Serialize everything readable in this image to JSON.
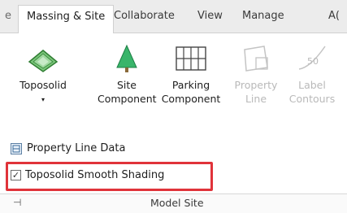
{
  "tabs": {
    "partial_left": "e",
    "items": [
      "Massing & Site",
      "Collaborate",
      "View",
      "Manage",
      "A("
    ]
  },
  "ribbon": {
    "toposolid": {
      "label": "Toposolid",
      "caret": "▾"
    },
    "site_component": {
      "line1": "Site",
      "line2": "Component"
    },
    "parking_component": {
      "line1": "Parking",
      "line2": "Component"
    },
    "property_line": {
      "line1": "Property",
      "line2": "Line"
    },
    "label_contours": {
      "line1": "Label",
      "line2": "Contours",
      "icon_text": "50"
    }
  },
  "panel": {
    "property_line_data": "Property Line Data",
    "smooth_shading": {
      "label": "Toposolid Smooth Shading",
      "checked": true
    },
    "title": "Model Site",
    "pin_glyph": "⊣"
  },
  "colors": {
    "highlight": "#e0333a",
    "toposolid_green": "#4aa64a",
    "tree_green": "#3cb371",
    "disabled": "#b9b9b9"
  }
}
